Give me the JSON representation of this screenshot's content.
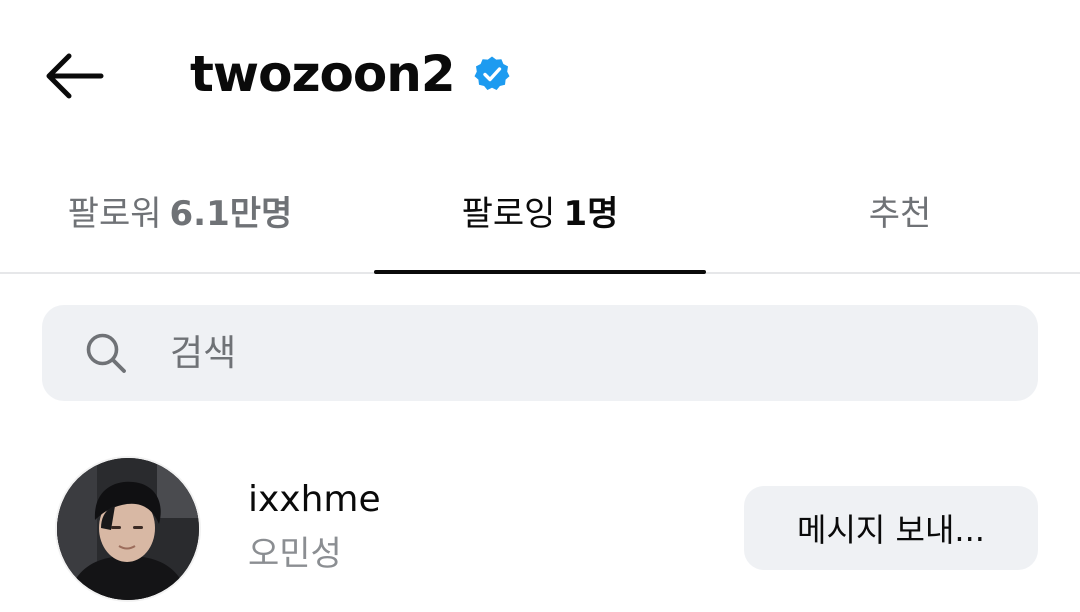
{
  "header": {
    "title": "twozoon2",
    "back_icon": "arrow-left-icon",
    "verified_icon": "verified-badge-icon",
    "verified_color": "#1d9bf0"
  },
  "tabs": [
    {
      "label": "팔로워",
      "count": "6.1만명",
      "active": false
    },
    {
      "label": "팔로잉",
      "count": "1명",
      "active": true
    },
    {
      "label": "추천",
      "count": "",
      "active": false
    }
  ],
  "search": {
    "icon": "search-icon",
    "placeholder": "검색",
    "value": ""
  },
  "following": [
    {
      "username": "ixxhme",
      "display_name": "오민성",
      "button_label": "메시지 보내..."
    }
  ],
  "colors": {
    "text_primary": "#0a0a0a",
    "text_secondary": "#6f7276",
    "surface": "#eff1f4",
    "accent": "#1d9bf0"
  }
}
